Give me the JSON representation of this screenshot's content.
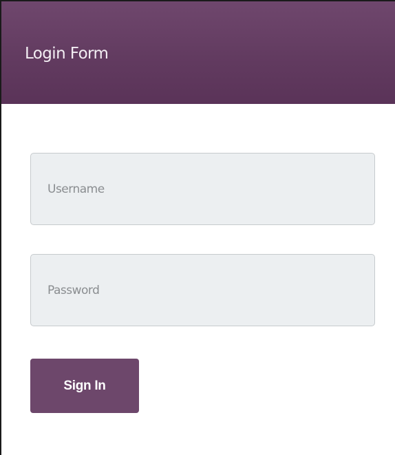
{
  "header": {
    "title": "Login Form"
  },
  "form": {
    "username": {
      "placeholder": "Username",
      "value": ""
    },
    "password": {
      "placeholder": "Password",
      "value": ""
    },
    "submit_label": "Sign In"
  },
  "colors": {
    "header_bg": "#623b60",
    "button_bg": "#6d476b",
    "input_bg": "#eceff1",
    "input_border": "#c6cacd"
  }
}
